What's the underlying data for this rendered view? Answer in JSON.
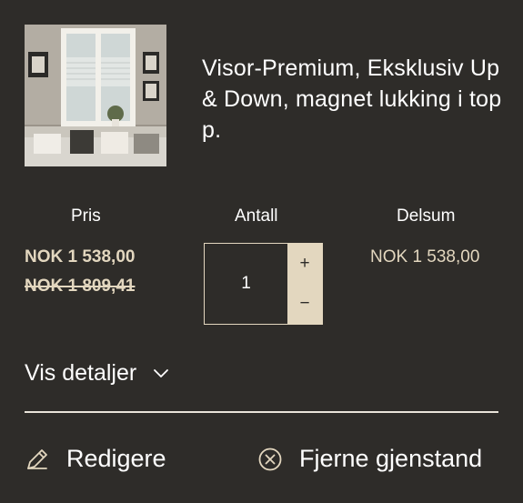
{
  "product": {
    "title": "Visor-Premium, Eksklusiv Up & Down, magnet lukking i topp.",
    "image_alt": "Living room window with pleated blinds"
  },
  "columns": {
    "price": "Pris",
    "quantity": "Antall",
    "subtotal": "Delsum"
  },
  "pricing": {
    "current": "NOK 1 538,00",
    "original": "NOK 1 809,41",
    "subtotal": "NOK 1 538,00"
  },
  "quantity": {
    "value": "1",
    "increase_label": "+",
    "decrease_label": "−"
  },
  "details": {
    "toggle_label": "Vis detaljer"
  },
  "actions": {
    "edit_label": "Redigere",
    "remove_label": "Fjerne gjenstand"
  },
  "colors": {
    "background": "#2e2c29",
    "accent": "#e3d7bf",
    "text": "#ffffff"
  },
  "icons": {
    "details": "chevron-down-icon",
    "edit": "pencil-icon",
    "remove": "close-circle-icon"
  }
}
